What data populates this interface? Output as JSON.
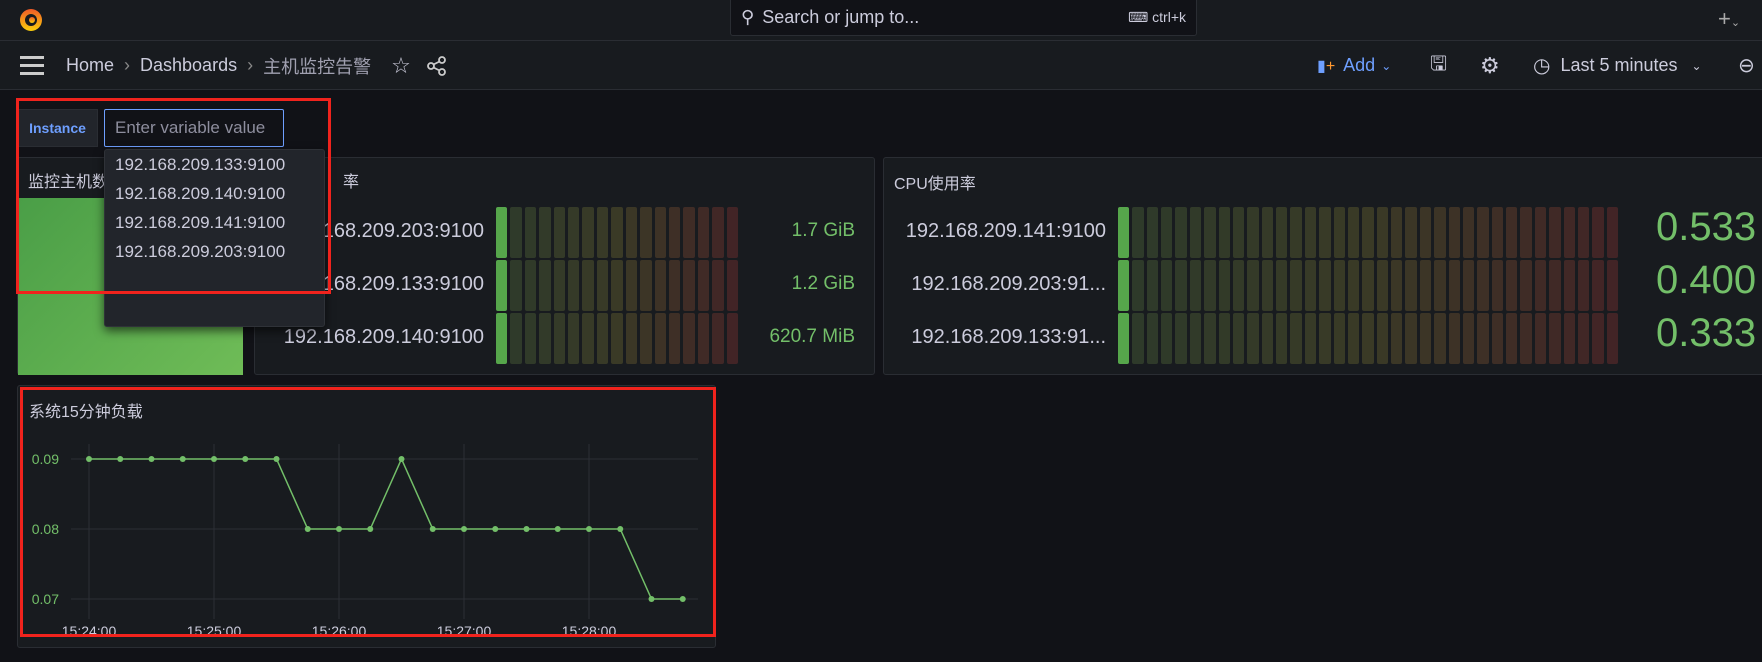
{
  "topbar": {
    "logo": "grafana-logo",
    "search_placeholder": "Search or jump to...",
    "search_shortcut": "ctrl+k",
    "new_icon": "plus-icon"
  },
  "breadcrumb": {
    "items": [
      "Home",
      "Dashboards",
      "主机监控告警"
    ],
    "separator": "›"
  },
  "toolbar": {
    "add_label": "Add",
    "time_range": "Last 5 minutes"
  },
  "variables": {
    "instance_label": "Instance",
    "instance_placeholder": "Enter variable value",
    "options": [
      "192.168.209.133:9100",
      "192.168.209.140:9100",
      "192.168.209.141:9100",
      "192.168.209.203:9100"
    ]
  },
  "panels": {
    "hosts": {
      "title": "监控主机数",
      "color": "#56a64b"
    },
    "memory": {
      "title": "率",
      "rows": [
        {
          "label": "192.168.209.203:9100",
          "value": "1.7 GiB",
          "fill": 0.06
        },
        {
          "label": "192.168.209.133:9100",
          "value": "1.2 GiB",
          "fill": 0.06
        },
        {
          "label": "192.168.209.140:9100",
          "value": "620.7 MiB",
          "fill": 0.06
        }
      ]
    },
    "cpu": {
      "title": "CPU使用率",
      "rows": [
        {
          "label": "192.168.209.141:9100",
          "value": "0.533",
          "fill": 0.03
        },
        {
          "label": "192.168.209.203:91...",
          "value": "0.400",
          "fill": 0.03
        },
        {
          "label": "192.168.209.133:91...",
          "value": "0.333",
          "fill": 0.03
        }
      ]
    },
    "load": {
      "title": "系统15分钟负载"
    }
  },
  "chart_data": {
    "type": "line",
    "title": "系统15分钟负载",
    "x": [
      "15:24:00",
      "15:24:15",
      "15:24:30",
      "15:24:45",
      "15:25:00",
      "15:25:15",
      "15:25:30",
      "15:25:45",
      "15:26:00",
      "15:26:15",
      "15:26:30",
      "15:26:45",
      "15:27:00",
      "15:27:15",
      "15:27:30",
      "15:27:45",
      "15:28:00",
      "15:28:15",
      "15:28:30",
      "15:28:45"
    ],
    "values": [
      0.09,
      0.09,
      0.09,
      0.09,
      0.09,
      0.09,
      0.09,
      0.08,
      0.08,
      0.08,
      0.09,
      0.08,
      0.08,
      0.08,
      0.08,
      0.08,
      0.08,
      0.08,
      0.07,
      0.07
    ],
    "x_ticks": [
      "15:24:00",
      "15:25:00",
      "15:26:00",
      "15:27:00",
      "15:28:00"
    ],
    "y_ticks": [
      "0.09",
      "0.08",
      "0.07"
    ],
    "ylim": [
      0.07,
      0.09
    ],
    "color": "#73bf69",
    "grid": true
  }
}
